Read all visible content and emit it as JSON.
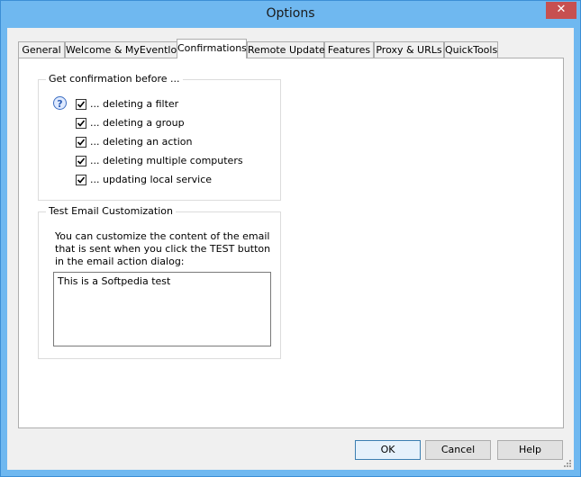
{
  "window": {
    "title": "Options",
    "close_glyph": "✕"
  },
  "tabs": [
    {
      "label": "General",
      "active": false
    },
    {
      "label": "Welcome & MyEventlog",
      "active": false
    },
    {
      "label": "Confirmations",
      "active": true
    },
    {
      "label": "Remote Update",
      "active": false
    },
    {
      "label": "Features",
      "active": false
    },
    {
      "label": "Proxy & URLs",
      "active": false
    },
    {
      "label": "QuickTools",
      "active": false
    }
  ],
  "confirm_group": {
    "title": "Get confirmation before ...",
    "help_icon": "?",
    "items": [
      {
        "label": "... deleting a filter",
        "checked": true
      },
      {
        "label": "... deleting a group",
        "checked": true
      },
      {
        "label": "... deleting an action",
        "checked": true
      },
      {
        "label": "... deleting multiple computers",
        "checked": true
      },
      {
        "label": "... updating local service",
        "checked": true
      }
    ]
  },
  "email_group": {
    "title": "Test Email Customization",
    "description": "You can customize the content of the email that is sent when you click the TEST button in the email action dialog:",
    "value": "This is a Softpedia test"
  },
  "buttons": {
    "ok": "OK",
    "cancel": "Cancel",
    "help": "Help"
  }
}
